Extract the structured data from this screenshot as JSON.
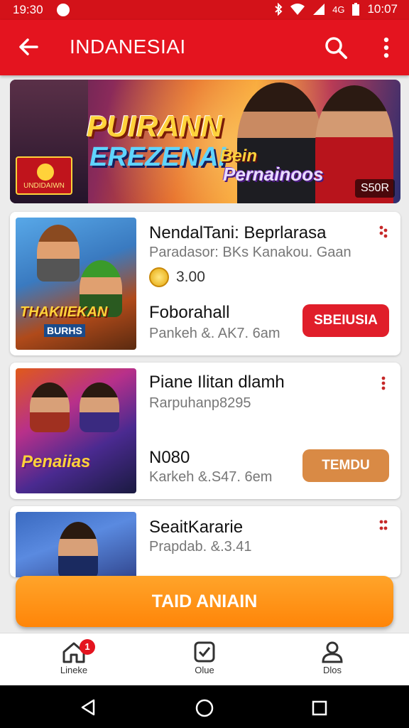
{
  "status_bar": {
    "time": "19:30",
    "right_time": "10:07",
    "signal_text": "4G"
  },
  "app_bar": {
    "title": "INDANESIAI"
  },
  "banner": {
    "headline_1": "PUIRANN",
    "headline_2": "EREZENAI",
    "logo_text": "UNDIDAIWN",
    "sub_1": "Bein",
    "sub_2": "Pernainoos",
    "tag": "S50R"
  },
  "cards": [
    {
      "title": "NendalTani: Beprlarasa",
      "subtitle": "Paradasor: BKs Kanakou. Gaan",
      "coin_value": "3.00",
      "stat": "Foborahall",
      "meta": "Pankeh &. AK7. 6am",
      "button": "SBEIUSIA",
      "button_color": "#e01e2a",
      "thumb_title": "THAKIIEKAN",
      "thumb_sub": "BURHS"
    },
    {
      "title": "Piane Ilitan dlamh",
      "subtitle": "Rarpuhanp8295",
      "stat": "N080",
      "meta": "Karkeh &.S47. 6em",
      "button": "TEMDU",
      "button_color": "#d98a45",
      "thumb_title": "Penaiias"
    },
    {
      "title": "SeaitKararie",
      "subtitle": "Prapdab. &.3.41"
    }
  ],
  "cta": {
    "label": "TAID ANIAIN"
  },
  "bottom_nav": [
    {
      "label": "Lineke",
      "icon": "home-icon",
      "badge": "1"
    },
    {
      "label": "Olue",
      "icon": "checkbox-icon"
    },
    {
      "label": "Dlos",
      "icon": "profile-icon"
    }
  ]
}
